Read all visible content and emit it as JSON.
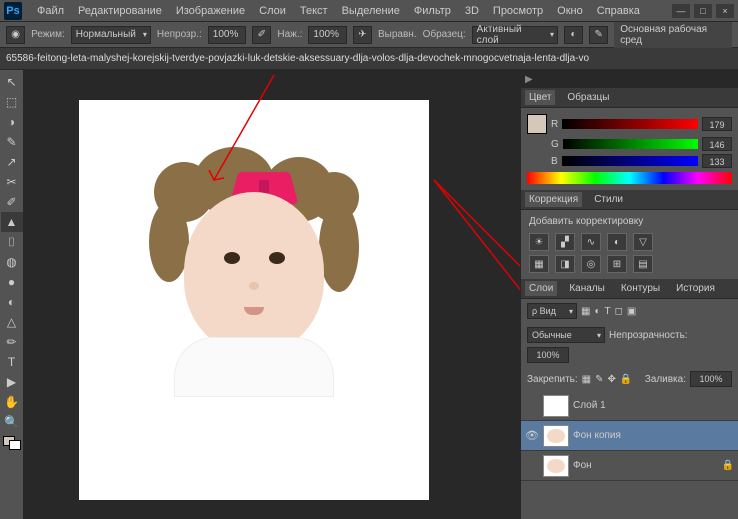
{
  "app": {
    "logo": "Ps"
  },
  "menu": [
    "Файл",
    "Редактирование",
    "Изображение",
    "Слои",
    "Текст",
    "Выделение",
    "Фильтр",
    "3D",
    "Просмотр",
    "Окно",
    "Справка"
  ],
  "options": {
    "mode_label": "Режим:",
    "mode_value": "Нормальный",
    "opacity_label": "Непрозр.:",
    "opacity_value": "100%",
    "flow_label": "Наж.:",
    "flow_value": "100%",
    "smooth_label": "Выравн.",
    "sample_label": "Образец:",
    "sample_value": "Активный слой",
    "workspace": "Основная рабочая сред"
  },
  "tab": {
    "title": "65586-feitong-leta-malyshej-korejskij-tverdye-povjazki-luk-detskie-aksessuary-dlja-volos-dlja-devochek-mnogocvetnaja-lenta-dlja-vo"
  },
  "panels": {
    "color_tab": "Цвет",
    "swatches_tab": "Образцы",
    "r_label": "R",
    "r_value": "179",
    "g_label": "G",
    "g_value": "146",
    "b_label": "B",
    "b_value": "133",
    "adjustments_tab": "Коррекция",
    "styles_tab": "Стили",
    "add_adjustment": "Добавить корректировку",
    "layers_tab": "Слои",
    "channels_tab": "Каналы",
    "paths_tab": "Контуры",
    "history_tab": "История",
    "kind_label": "ρ Вид",
    "blend_mode": "Обычные",
    "opacity_label2": "Непрозрачность:",
    "opacity_value2": "100%",
    "lock_label": "Закрепить:",
    "fill_label": "Заливка:",
    "fill_value": "100%",
    "layers": [
      {
        "name": "Слой 1",
        "visible": false,
        "selected": false,
        "thumb": "blank",
        "locked": false
      },
      {
        "name": "Фон копия",
        "visible": true,
        "selected": true,
        "thumb": "face",
        "locked": false
      },
      {
        "name": "Фон",
        "visible": false,
        "selected": false,
        "thumb": "face",
        "locked": true
      }
    ]
  },
  "tools": [
    "↖",
    "⬚",
    "◑",
    "✎",
    "↗",
    "✂",
    "✐",
    "▲",
    "⌷",
    "◍",
    "●",
    "◐",
    "△",
    "✏",
    "T",
    "▶",
    "✋",
    "🔍"
  ]
}
